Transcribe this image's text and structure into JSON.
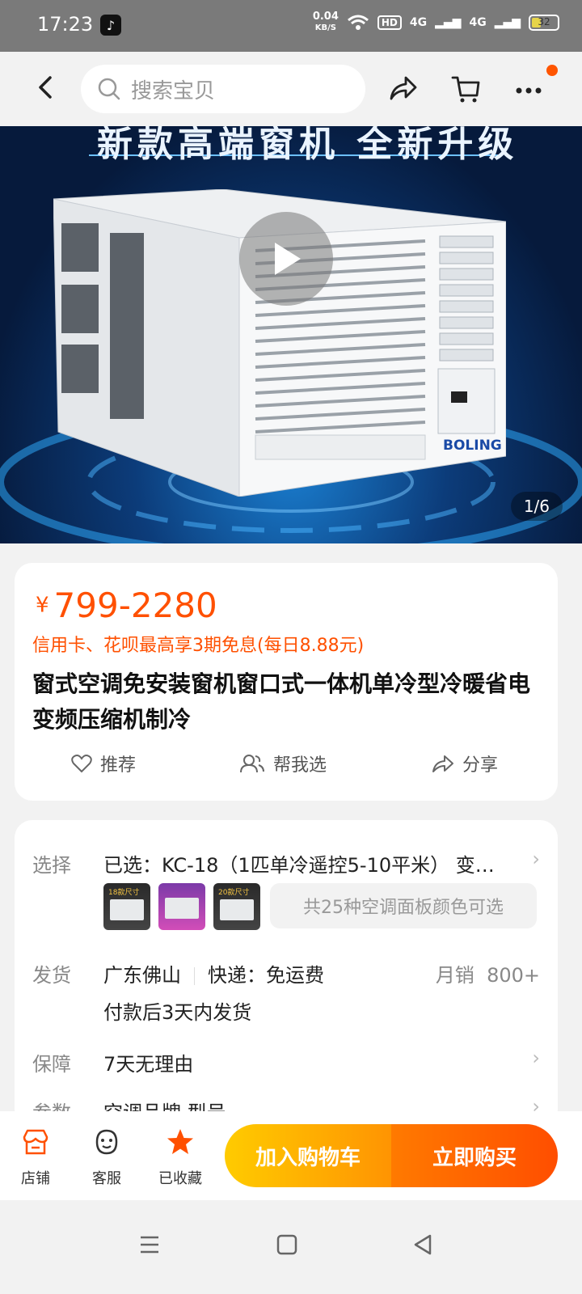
{
  "status_bar": {
    "time": "17:23",
    "net_speed_value": "0.04",
    "net_speed_unit": "KB/S",
    "hd_label": "HD",
    "signal1": "4G",
    "signal2": "4G",
    "battery": "32"
  },
  "nav": {
    "search_placeholder": "搜索宝贝"
  },
  "hero": {
    "banner_text": "新款高端窗机   全新升级",
    "brand": "BOLING",
    "pager": "1/6"
  },
  "product": {
    "currency": "¥",
    "price_range": "799-2280",
    "promo": "信用卡、花呗最高享3期免息(每日8.88元)",
    "title": "窗式空调免安装窗机窗口式一体机单冷型冷暖省电变频压缩机制冷",
    "actions": {
      "recommend": "推荐",
      "help_choose": "帮我选",
      "share": "分享"
    }
  },
  "spec": {
    "select_label": "选择",
    "select_value": "已选：KC-18（1匹单冷遥控5-10平米） 变…",
    "thumbs": [
      "18款尺寸",
      "",
      "20款尺寸"
    ],
    "colors_note": "共25种空调面板颜色可选",
    "ship_label": "发货",
    "ship_from": "广东佛山",
    "express": "快递：免运费",
    "monthly_sales_label": "月销",
    "monthly_sales_value": "800+",
    "ship_time": "付款后3天内发货",
    "guarantee_label": "保障",
    "guarantee_value": "7天无理由",
    "params_label": "参数",
    "params_value": "空调品牌 型号"
  },
  "bottom_bar": {
    "store": "店铺",
    "service": "客服",
    "favorited": "已收藏",
    "add_to_cart": "加入购物车",
    "buy_now": "立即购买"
  },
  "colors": {
    "accent": "#ff5000",
    "cart_gradient_start": "#ffcb00",
    "buy_gradient_end": "#ff4e00"
  }
}
